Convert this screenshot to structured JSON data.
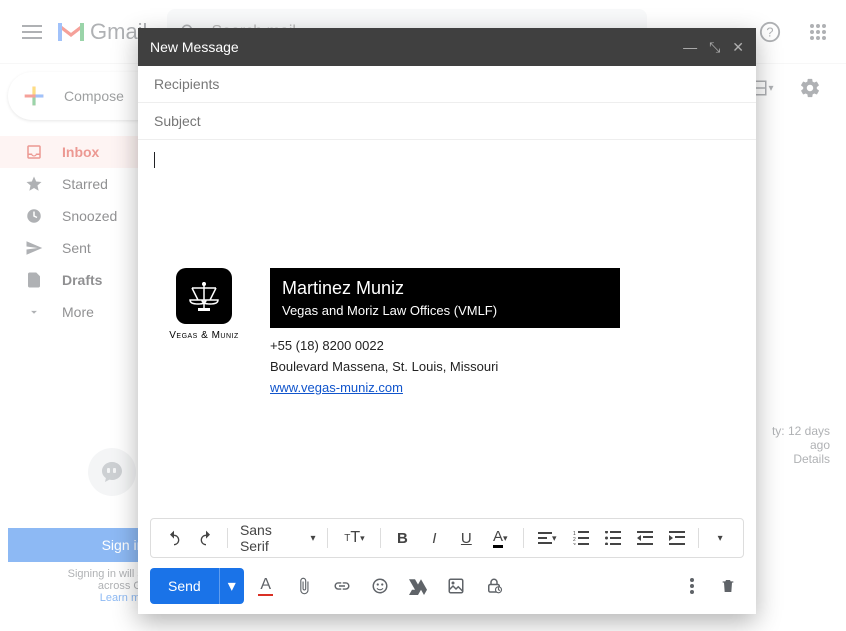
{
  "header": {
    "logo_text": "Gmail",
    "search_placeholder": "Search mail"
  },
  "compose_button": "Compose",
  "sidebar": {
    "items": [
      {
        "label": "Inbox",
        "active": true
      },
      {
        "label": "Starred"
      },
      {
        "label": "Snoozed"
      },
      {
        "label": "Sent"
      },
      {
        "label": "Drafts",
        "bold": true
      },
      {
        "label": "More"
      }
    ]
  },
  "activity": {
    "line1": "ty: 12 days",
    "line2": "ago",
    "details": "Details"
  },
  "signin": {
    "button": "Sign in",
    "text1": "Signing in will sign you",
    "text2": "across Go",
    "learn": "Learn mo"
  },
  "compose": {
    "title": "New Message",
    "recipients_label": "Recipients",
    "subject_label": "Subject",
    "font_name": "Sans Serif",
    "send_label": "Send",
    "signature": {
      "logo_caption": "Vegas & Muniz",
      "name": "Martinez Muniz",
      "company": "Vegas and Moriz Law Offices (VMLF)",
      "phone": "+55 (18) 8200 0022",
      "address": "Boulevard Massena, St. Louis, Missouri",
      "website": "www.vegas-muniz.com"
    }
  }
}
